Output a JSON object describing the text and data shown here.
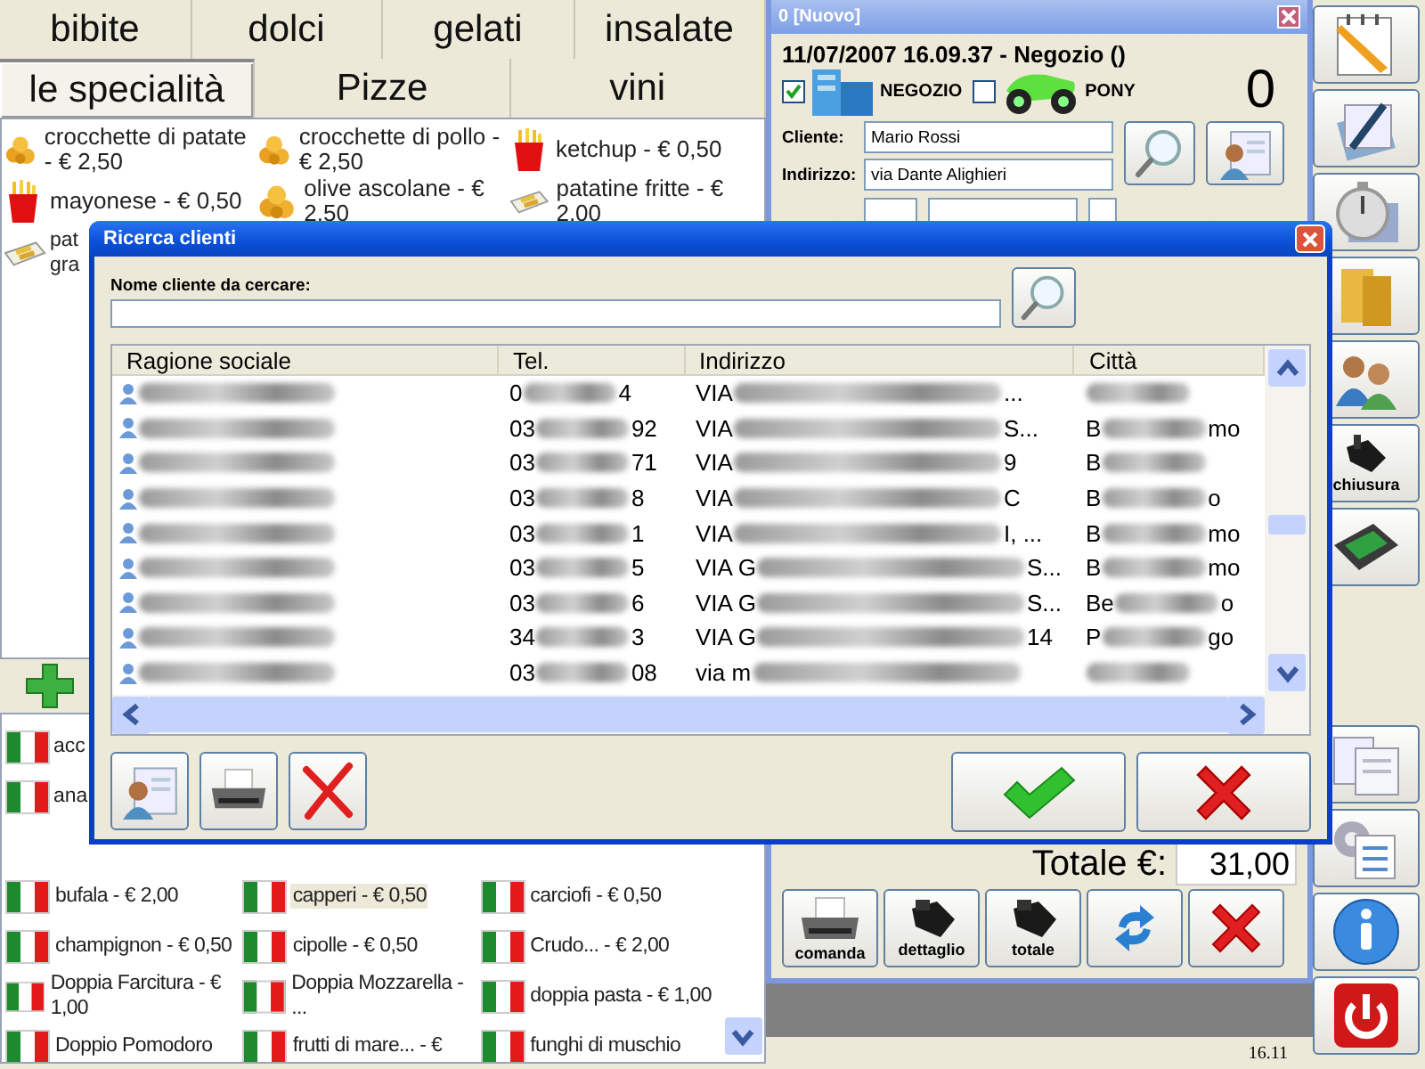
{
  "category_tabs": [
    {
      "tabs": [
        {
          "label": "bibite",
          "selected": false
        },
        {
          "label": "dolci",
          "selected": false
        },
        {
          "label": "gelati",
          "selected": false
        },
        {
          "label": "insalate",
          "selected": false
        }
      ]
    },
    {
      "tabs": [
        {
          "label": "le specialità",
          "selected": true
        },
        {
          "label": "Pizze",
          "selected": false
        },
        {
          "label": "vini",
          "selected": false
        }
      ]
    }
  ],
  "specials_menu": {
    "items": [
      {
        "label": "crocchette di patate - € 2,50",
        "kind": "nuggets"
      },
      {
        "label": "crocchette di pollo - € 2,50",
        "kind": "nuggets"
      },
      {
        "label": "ketchup - € 0,50",
        "kind": "fries"
      },
      {
        "label": "mayonese - € 0,50",
        "kind": "fries"
      },
      {
        "label": "olive ascolane - € 2,50",
        "kind": "nuggets"
      },
      {
        "label": "patatine fritte - € 2,00",
        "kind": "tray"
      },
      {
        "label": "pat gra",
        "kind": "tray"
      }
    ]
  },
  "toppings_menu": {
    "items": [
      {
        "label": "acc",
        "selected": false,
        "kind": "partial"
      },
      {
        "label": "ana",
        "selected": false,
        "kind": "partial"
      },
      {
        "label": "bufala - € 2,00",
        "selected": false,
        "kind": "full"
      },
      {
        "label": "capperi - € 0,50",
        "selected": true,
        "kind": "full"
      },
      {
        "label": "carciofi - € 0,50",
        "selected": false,
        "kind": "full"
      },
      {
        "label": "champignon - € 0,50",
        "selected": false,
        "kind": "full"
      },
      {
        "label": "cipolle - € 0,50",
        "selected": false,
        "kind": "full"
      },
      {
        "label": "Crudo... - € 2,00",
        "selected": false,
        "kind": "full"
      },
      {
        "label": "Doppia Farcitura - € 1,00",
        "selected": false,
        "kind": "full"
      },
      {
        "label": "Doppia Mozzarella - ...",
        "selected": false,
        "kind": "full"
      },
      {
        "label": "doppia pasta - € 1,00",
        "selected": false,
        "kind": "full"
      },
      {
        "label": "Doppio Pomodoro",
        "selected": false,
        "kind": "full"
      },
      {
        "label": "frutti di mare... - €",
        "selected": false,
        "kind": "full"
      },
      {
        "label": "funghi di muschio",
        "selected": false,
        "kind": "full"
      }
    ]
  },
  "order": {
    "title": "0 [Nuovo]",
    "header": "11/07/2007 16.09.37 - Negozio ()",
    "channels": [
      {
        "label": "NEGOZIO",
        "checked": true,
        "kind": "shop"
      },
      {
        "label": "PONY",
        "checked": false,
        "kind": "scooter"
      }
    ],
    "count": "0",
    "fields": [
      {
        "label": "Cliente:",
        "value": "Mario Rossi"
      },
      {
        "label": "Indirizzo:",
        "value": "via Dante Alighieri"
      }
    ],
    "total_label": "Totale €:",
    "total": "31,00",
    "actions": [
      {
        "label": "comanda",
        "kind": "printer"
      },
      {
        "label": "dettaglio",
        "kind": "register"
      },
      {
        "label": "totale",
        "kind": "register"
      },
      {
        "kind": "refresh"
      },
      {
        "kind": "cancel"
      }
    ]
  },
  "status_bar": {
    "time": "16.11"
  },
  "sidebar": {
    "top": [
      {
        "kind": "new-order"
      },
      {
        "kind": "notes"
      },
      {
        "kind": "stopwatch"
      },
      {
        "kind": "folder"
      },
      {
        "kind": "people"
      },
      {
        "kind": "closing",
        "label": "chiusura"
      },
      {
        "kind": "cash"
      }
    ],
    "bottom": [
      {
        "kind": "pony-docs"
      },
      {
        "kind": "settings"
      },
      {
        "kind": "info"
      },
      {
        "kind": "power"
      }
    ]
  },
  "dialog": {
    "title": "Ricerca clienti",
    "search_label": "Nome cliente da cercare:",
    "columns": [
      "Ragione sociale",
      "Tel.",
      "Indirizzo",
      "Città"
    ],
    "rows": [
      {
        "name": [
          {
            "kind": "blur"
          }
        ],
        "tel": [
          {
            "kind": "text",
            "text": "0"
          },
          {
            "kind": "blur"
          },
          {
            "kind": "text",
            "text": "4"
          }
        ],
        "address": [
          {
            "kind": "text",
            "text": "VIA"
          },
          {
            "kind": "blur"
          },
          {
            "kind": "text",
            "text": "..."
          }
        ],
        "city": [
          {
            "kind": "blur"
          }
        ]
      },
      {
        "name": [
          {
            "kind": "blur"
          }
        ],
        "tel": [
          {
            "kind": "text",
            "text": "03"
          },
          {
            "kind": "blur"
          },
          {
            "kind": "text",
            "text": "92"
          }
        ],
        "address": [
          {
            "kind": "text",
            "text": "VIA"
          },
          {
            "kind": "blur"
          },
          {
            "kind": "text",
            "text": "S..."
          }
        ],
        "city": [
          {
            "kind": "text",
            "text": "B"
          },
          {
            "kind": "blur"
          },
          {
            "kind": "text",
            "text": "mo"
          }
        ]
      },
      {
        "name": [
          {
            "kind": "blur"
          }
        ],
        "tel": [
          {
            "kind": "text",
            "text": "03"
          },
          {
            "kind": "blur"
          },
          {
            "kind": "text",
            "text": "71"
          }
        ],
        "address": [
          {
            "kind": "text",
            "text": "VIA"
          },
          {
            "kind": "blur"
          },
          {
            "kind": "text",
            "text": "9"
          }
        ],
        "city": [
          {
            "kind": "text",
            "text": "B"
          },
          {
            "kind": "blur"
          }
        ]
      },
      {
        "name": [
          {
            "kind": "blur"
          }
        ],
        "tel": [
          {
            "kind": "text",
            "text": "03"
          },
          {
            "kind": "blur"
          },
          {
            "kind": "text",
            "text": "8"
          }
        ],
        "address": [
          {
            "kind": "text",
            "text": "VIA"
          },
          {
            "kind": "blur"
          },
          {
            "kind": "text",
            "text": "C"
          }
        ],
        "city": [
          {
            "kind": "text",
            "text": "B"
          },
          {
            "kind": "blur"
          },
          {
            "kind": "text",
            "text": "o"
          }
        ]
      },
      {
        "name": [
          {
            "kind": "blur"
          }
        ],
        "tel": [
          {
            "kind": "text",
            "text": "03"
          },
          {
            "kind": "blur"
          },
          {
            "kind": "text",
            "text": "1"
          }
        ],
        "address": [
          {
            "kind": "text",
            "text": "VIA"
          },
          {
            "kind": "blur"
          },
          {
            "kind": "text",
            "text": "I, ..."
          }
        ],
        "city": [
          {
            "kind": "text",
            "text": "B"
          },
          {
            "kind": "blur"
          },
          {
            "kind": "text",
            "text": "mo"
          }
        ]
      },
      {
        "name": [
          {
            "kind": "blur"
          }
        ],
        "tel": [
          {
            "kind": "text",
            "text": "03"
          },
          {
            "kind": "blur"
          },
          {
            "kind": "text",
            "text": "5"
          }
        ],
        "address": [
          {
            "kind": "text",
            "text": "VIA G"
          },
          {
            "kind": "blur"
          },
          {
            "kind": "text",
            "text": "S..."
          }
        ],
        "city": [
          {
            "kind": "text",
            "text": "B"
          },
          {
            "kind": "blur"
          },
          {
            "kind": "text",
            "text": "mo"
          }
        ]
      },
      {
        "name": [
          {
            "kind": "blur"
          }
        ],
        "tel": [
          {
            "kind": "text",
            "text": "03"
          },
          {
            "kind": "blur"
          },
          {
            "kind": "text",
            "text": "6"
          }
        ],
        "address": [
          {
            "kind": "text",
            "text": "VIA G"
          },
          {
            "kind": "blur"
          },
          {
            "kind": "text",
            "text": "S..."
          }
        ],
        "city": [
          {
            "kind": "text",
            "text": "Be"
          },
          {
            "kind": "blur"
          },
          {
            "kind": "text",
            "text": "o"
          }
        ]
      },
      {
        "name": [
          {
            "kind": "blur"
          }
        ],
        "tel": [
          {
            "kind": "text",
            "text": "34"
          },
          {
            "kind": "blur"
          },
          {
            "kind": "text",
            "text": "3"
          }
        ],
        "address": [
          {
            "kind": "text",
            "text": "VIA G"
          },
          {
            "kind": "blur"
          },
          {
            "kind": "text",
            "text": "14"
          }
        ],
        "city": [
          {
            "kind": "text",
            "text": "P"
          },
          {
            "kind": "blur"
          },
          {
            "kind": "text",
            "text": "go"
          }
        ]
      },
      {
        "name": [
          {
            "kind": "blur"
          }
        ],
        "tel": [
          {
            "kind": "text",
            "text": "03"
          },
          {
            "kind": "blur"
          },
          {
            "kind": "text",
            "text": "08"
          }
        ],
        "address": [
          {
            "kind": "text",
            "text": "via m"
          },
          {
            "kind": "blur"
          }
        ],
        "city": [
          {
            "kind": "blur"
          }
        ]
      }
    ]
  }
}
